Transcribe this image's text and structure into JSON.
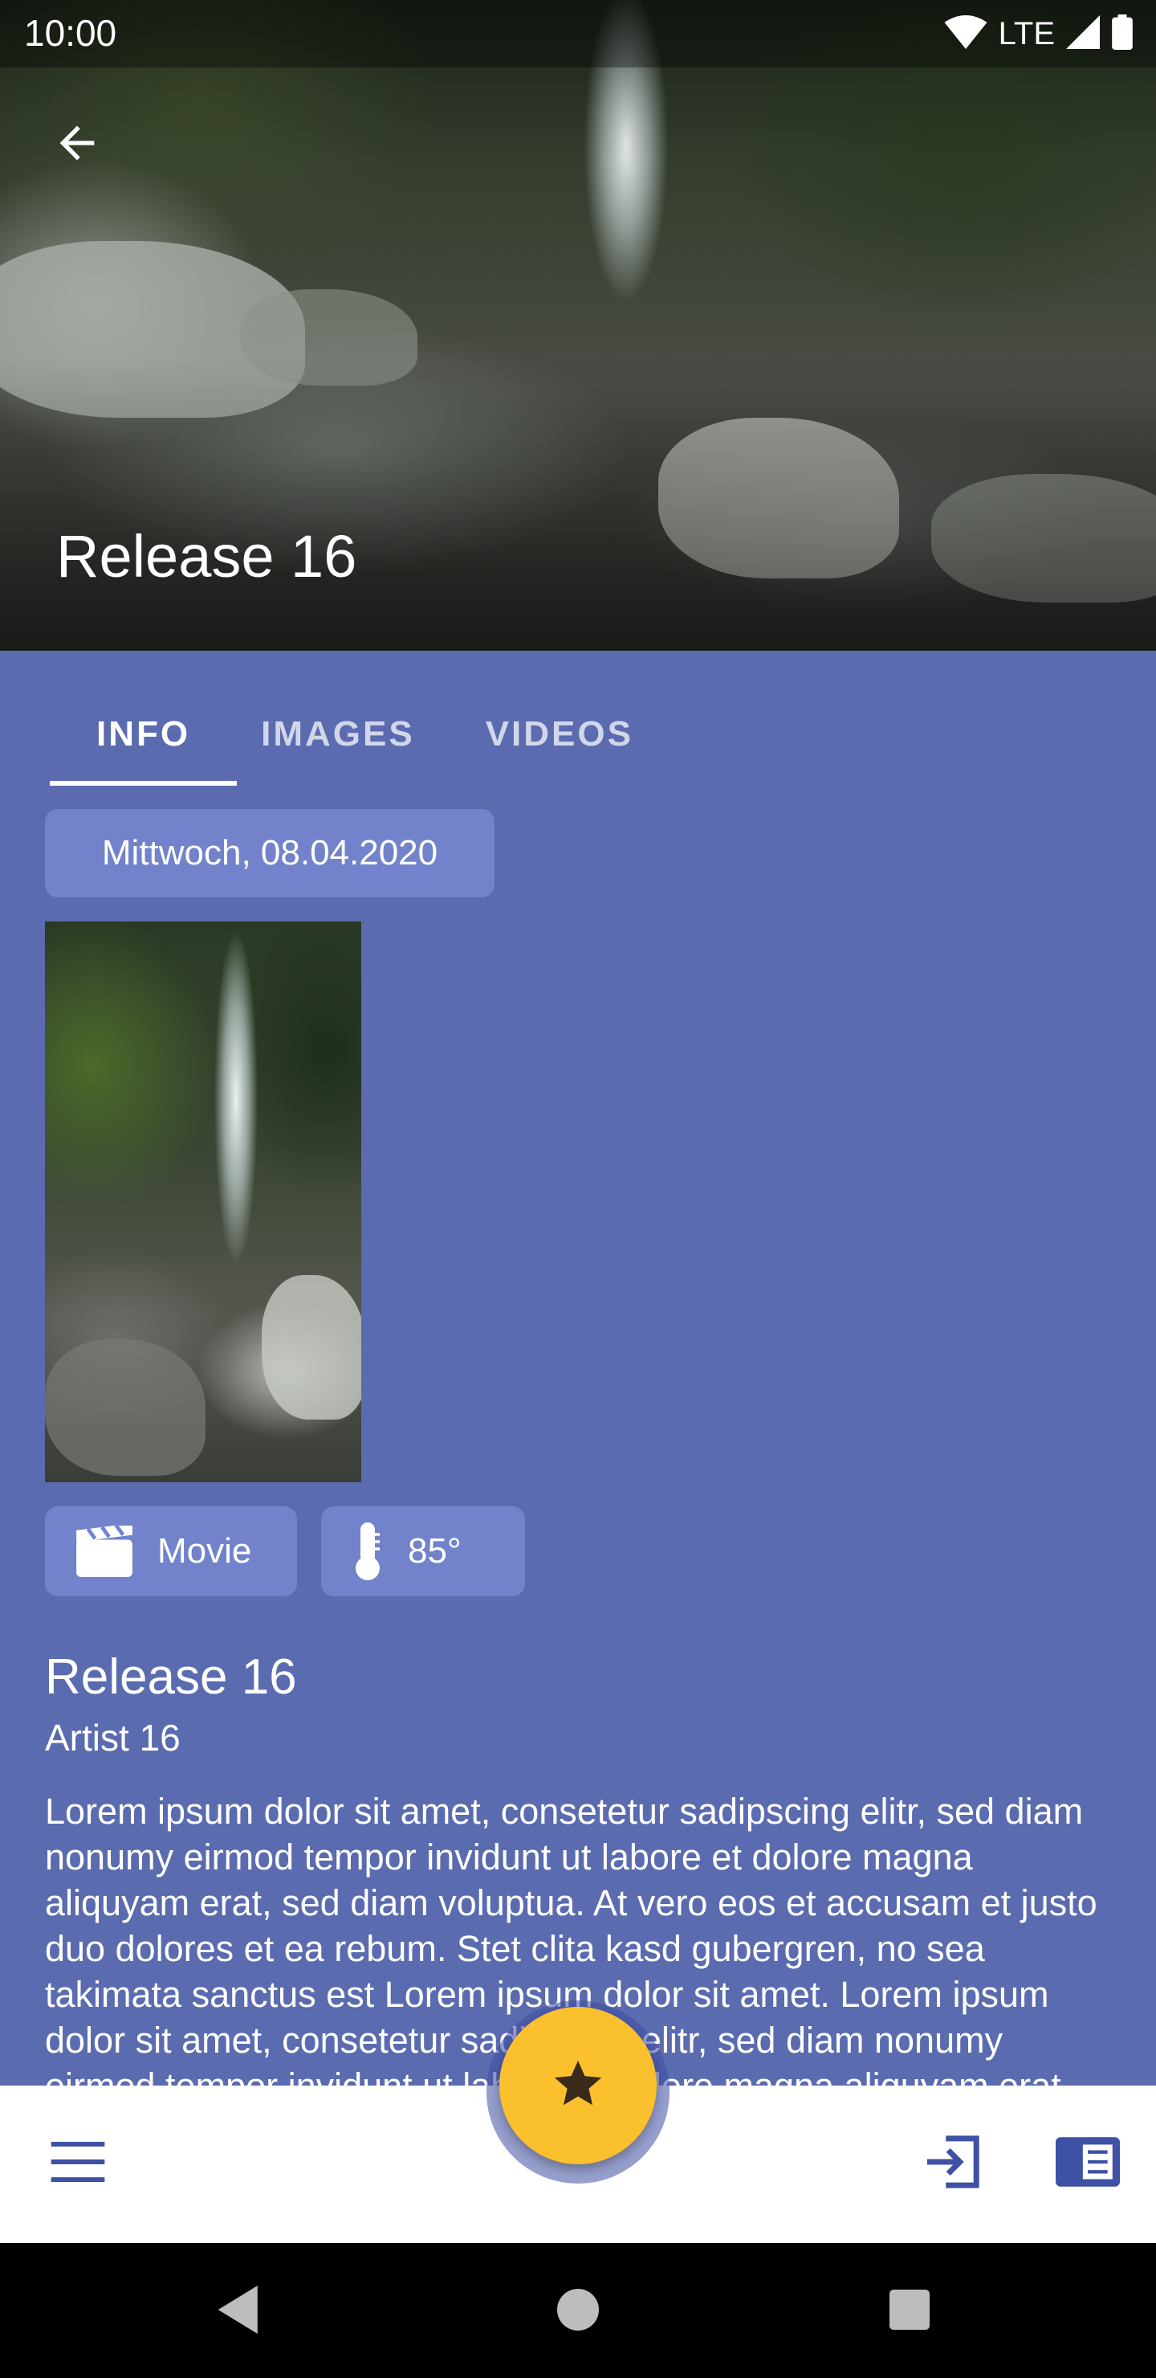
{
  "status_bar": {
    "time": "10:00",
    "network": "LTE"
  },
  "header": {
    "title": "Release 16"
  },
  "tabs": [
    {
      "label": "INFO",
      "active": true
    },
    {
      "label": "IMAGES",
      "active": false
    },
    {
      "label": "VIDEOS",
      "active": false
    }
  ],
  "info": {
    "date": "Mittwoch, 08.04.2020",
    "type_chip": {
      "label": "Movie",
      "icon": "clapperboard-icon"
    },
    "rating_chip": {
      "label": "85°",
      "icon": "thermometer-icon"
    },
    "title": "Release 16",
    "artist": "Artist 16",
    "description": "Lorem ipsum dolor sit amet, consetetur sadipscing elitr, sed diam nonumy eirmod tempor invidunt ut labore et dolore magna aliquyam erat, sed diam voluptua. At vero eos et accusam et justo duo dolores et ea rebum. Stet clita kasd gubergren, no sea takimata sanctus est Lorem ipsum dolor sit amet. Lorem ipsum dolor sit amet, consetetur sadipscing elitr, sed diam nonumy eirmod tempor invidunt ut labore et dolore magna aliquyam erat, sed diam voluptua."
  },
  "bottom_bar": {
    "fab_icon": "star-icon",
    "left_icon": "menu-icon",
    "right_icons": [
      "login-icon",
      "reader-icon"
    ]
  },
  "colors": {
    "background": "#5B6BAF",
    "chip": "#7283CB",
    "fab": "#FBC02D",
    "accent": "#3F51A5"
  }
}
